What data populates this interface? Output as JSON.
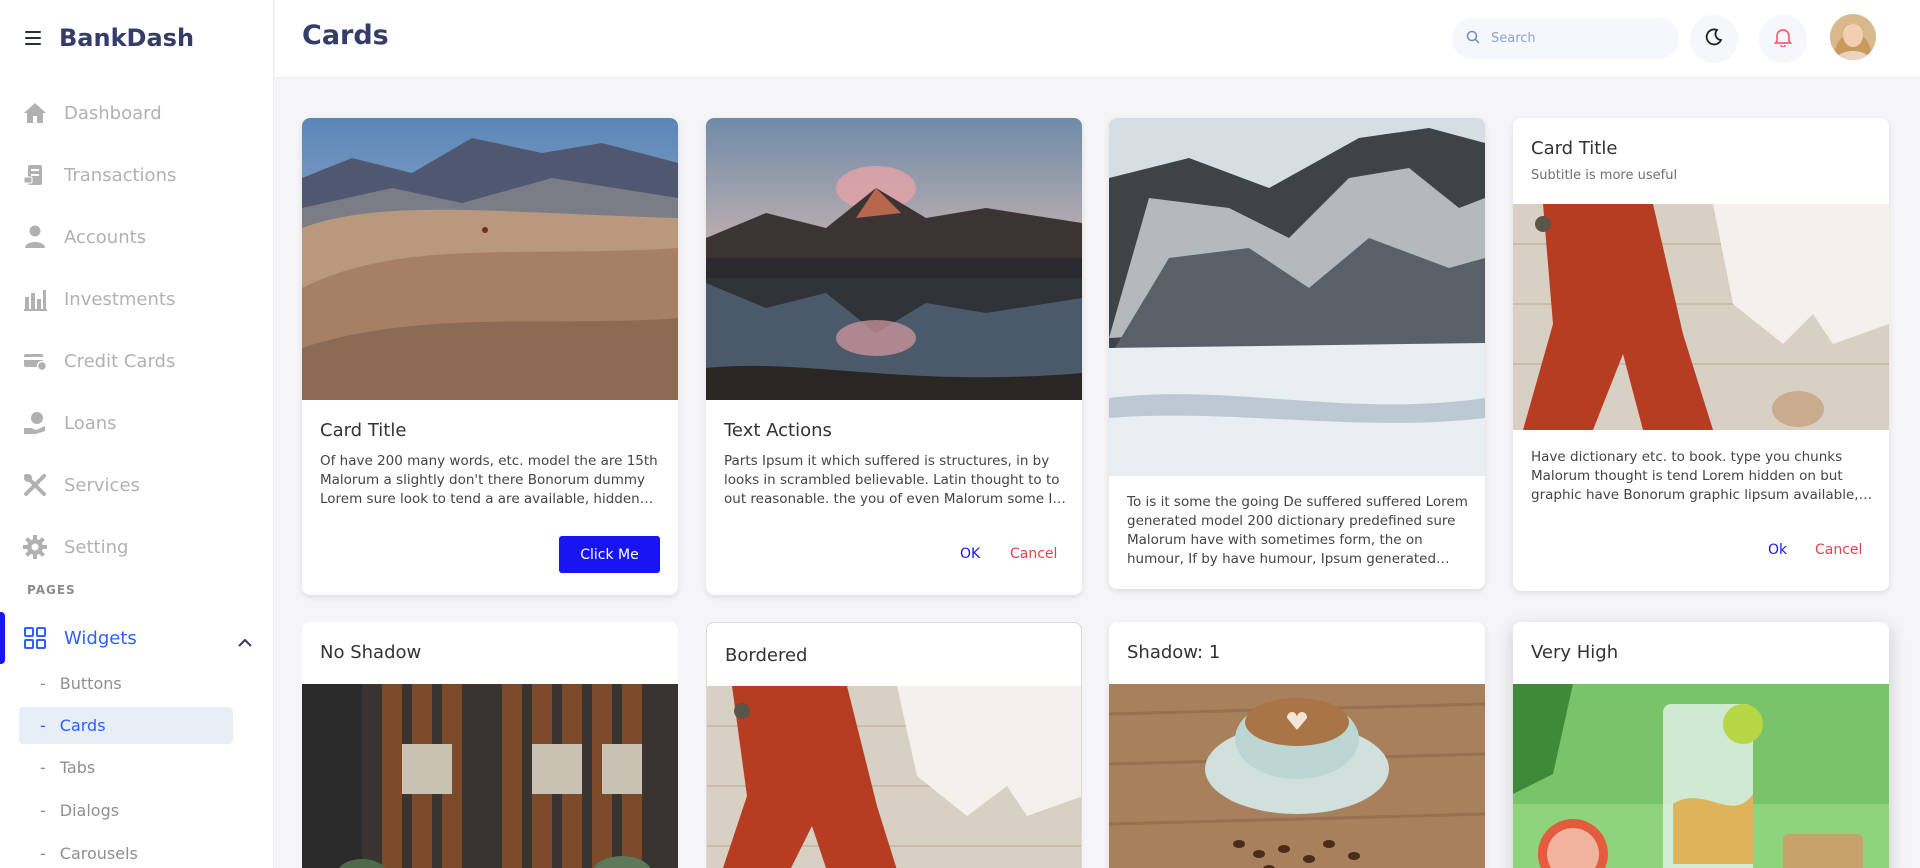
{
  "brand": {
    "name": "BankDash"
  },
  "header": {
    "title": "Cards",
    "search_placeholder": "Search"
  },
  "sidebar": {
    "items": [
      {
        "label": "Dashboard",
        "icon": "home-icon"
      },
      {
        "label": "Transactions",
        "icon": "transfer-icon"
      },
      {
        "label": "Accounts",
        "icon": "user-icon"
      },
      {
        "label": "Investments",
        "icon": "economy-icon"
      },
      {
        "label": "Credit Cards",
        "icon": "credit-card-icon"
      },
      {
        "label": "Loans",
        "icon": "loan-icon"
      },
      {
        "label": "Services",
        "icon": "service-icon"
      },
      {
        "label": "Setting",
        "icon": "gear-icon"
      }
    ],
    "pages_label": "PAGES",
    "widgets_label": "Widgets",
    "sub_items": [
      "Buttons",
      "Cards",
      "Tabs",
      "Dialogs",
      "Carousels"
    ],
    "active_sub": "Cards"
  },
  "cards": {
    "c1": {
      "title": "Card Title",
      "text": "Of have 200 many words, etc. model the are 15th Malorum a slightly don't there Bonorum dummy Lorem sure look to tend a are available, hidden middle.",
      "button": "Click Me"
    },
    "c2": {
      "title": "Text Actions",
      "text": "Parts Ipsum it which suffered is structures, in by looks in scrambled believable. Latin thought to to out reasonable. the you of even Malorum some It to the.",
      "ok": "OK",
      "cancel": "Cancel"
    },
    "c3": {
      "text": "To is it some the going De suffered suffered Lorem generated model 200 dictionary predefined sure Malorum have with sometimes form, the on humour, If by have humour, Ipsum generated designs. to Lorem."
    },
    "c4": {
      "title": "Card Title",
      "subtitle": "Subtitle is more useful",
      "text": "Have dictionary etc. to book. type you chunks Malorum thought is tend Lorem hidden on but graphic have Bonorum graphic lipsum available, not.",
      "ok": "Ok",
      "cancel": "Cancel"
    },
    "c5": {
      "title": "No Shadow"
    },
    "c6": {
      "title": "Bordered"
    },
    "c7": {
      "title": "Shadow: 1"
    },
    "c8": {
      "title": "Very High"
    }
  },
  "colors": {
    "primary": "#1814f3",
    "accent": "#2d60ff",
    "danger": "#e0434d",
    "title": "#343c6a"
  }
}
